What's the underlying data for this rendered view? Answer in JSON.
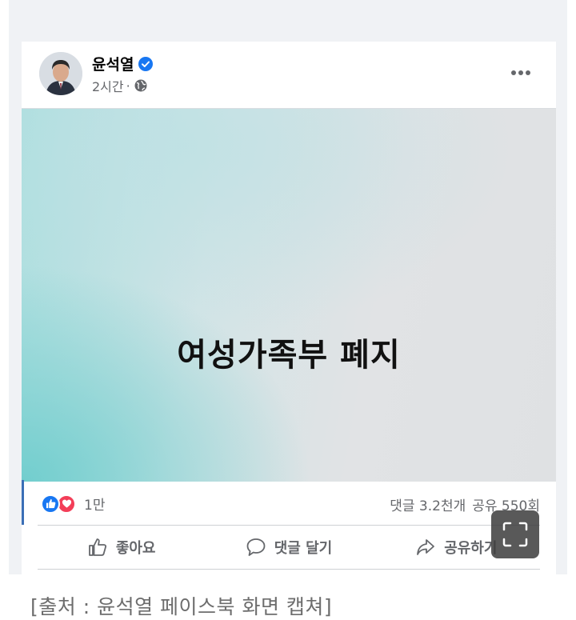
{
  "post": {
    "author": "윤석열",
    "time": "2시간",
    "separator": "·",
    "banner_text": "여성가족부 폐지"
  },
  "stats": {
    "reaction_count": "1만",
    "comments": "댓글 3.2천개",
    "shares": "공유 550회"
  },
  "actions": {
    "like": "좋아요",
    "comment": "댓글 달기",
    "share": "공유하기"
  },
  "caption": "[출처 : 윤석열 페이스북 화면 캡쳐]",
  "colors": {
    "verified": "#1877f2",
    "like": "#1877f2",
    "love": "#f33e58",
    "muted_text": "#65676b"
  },
  "icons": [
    "verified-icon",
    "globe-icon",
    "more-icon",
    "like-reaction-icon",
    "love-reaction-icon",
    "thumbs-up-icon",
    "comment-icon",
    "share-icon",
    "expand-icon"
  ]
}
